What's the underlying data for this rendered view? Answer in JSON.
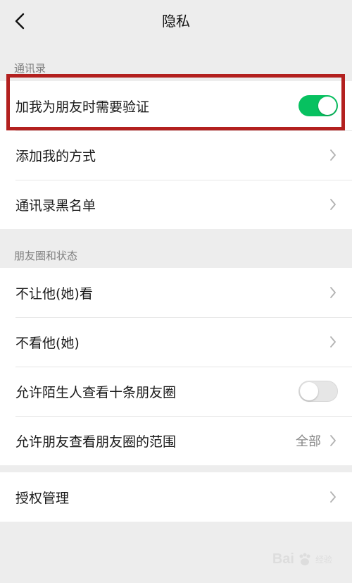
{
  "nav": {
    "title": "隐私",
    "back_icon": "chevron-left-icon"
  },
  "sections": {
    "contacts": {
      "label": "通讯录",
      "rows": [
        {
          "label": "加我为朋友时需要验证",
          "toggle": "on"
        },
        {
          "label": "添加我的方式"
        },
        {
          "label": "通讯录黑名单"
        }
      ]
    },
    "moments": {
      "label": "朋友圈和状态",
      "rows": [
        {
          "label": "不让他(她)看"
        },
        {
          "label": "不看他(她)"
        },
        {
          "label": "允许陌生人查看十条朋友圈",
          "toggle": "off"
        },
        {
          "label": "允许朋友查看朋友圈的范围",
          "value": "全部"
        }
      ]
    },
    "auth": {
      "rows": [
        {
          "label": "授权管理"
        }
      ]
    }
  },
  "colors": {
    "toggle_on": "#07c160",
    "highlight": "#b3201f",
    "background": "#ededed"
  },
  "watermark": {
    "text": "Bai",
    "sub": "经验"
  }
}
